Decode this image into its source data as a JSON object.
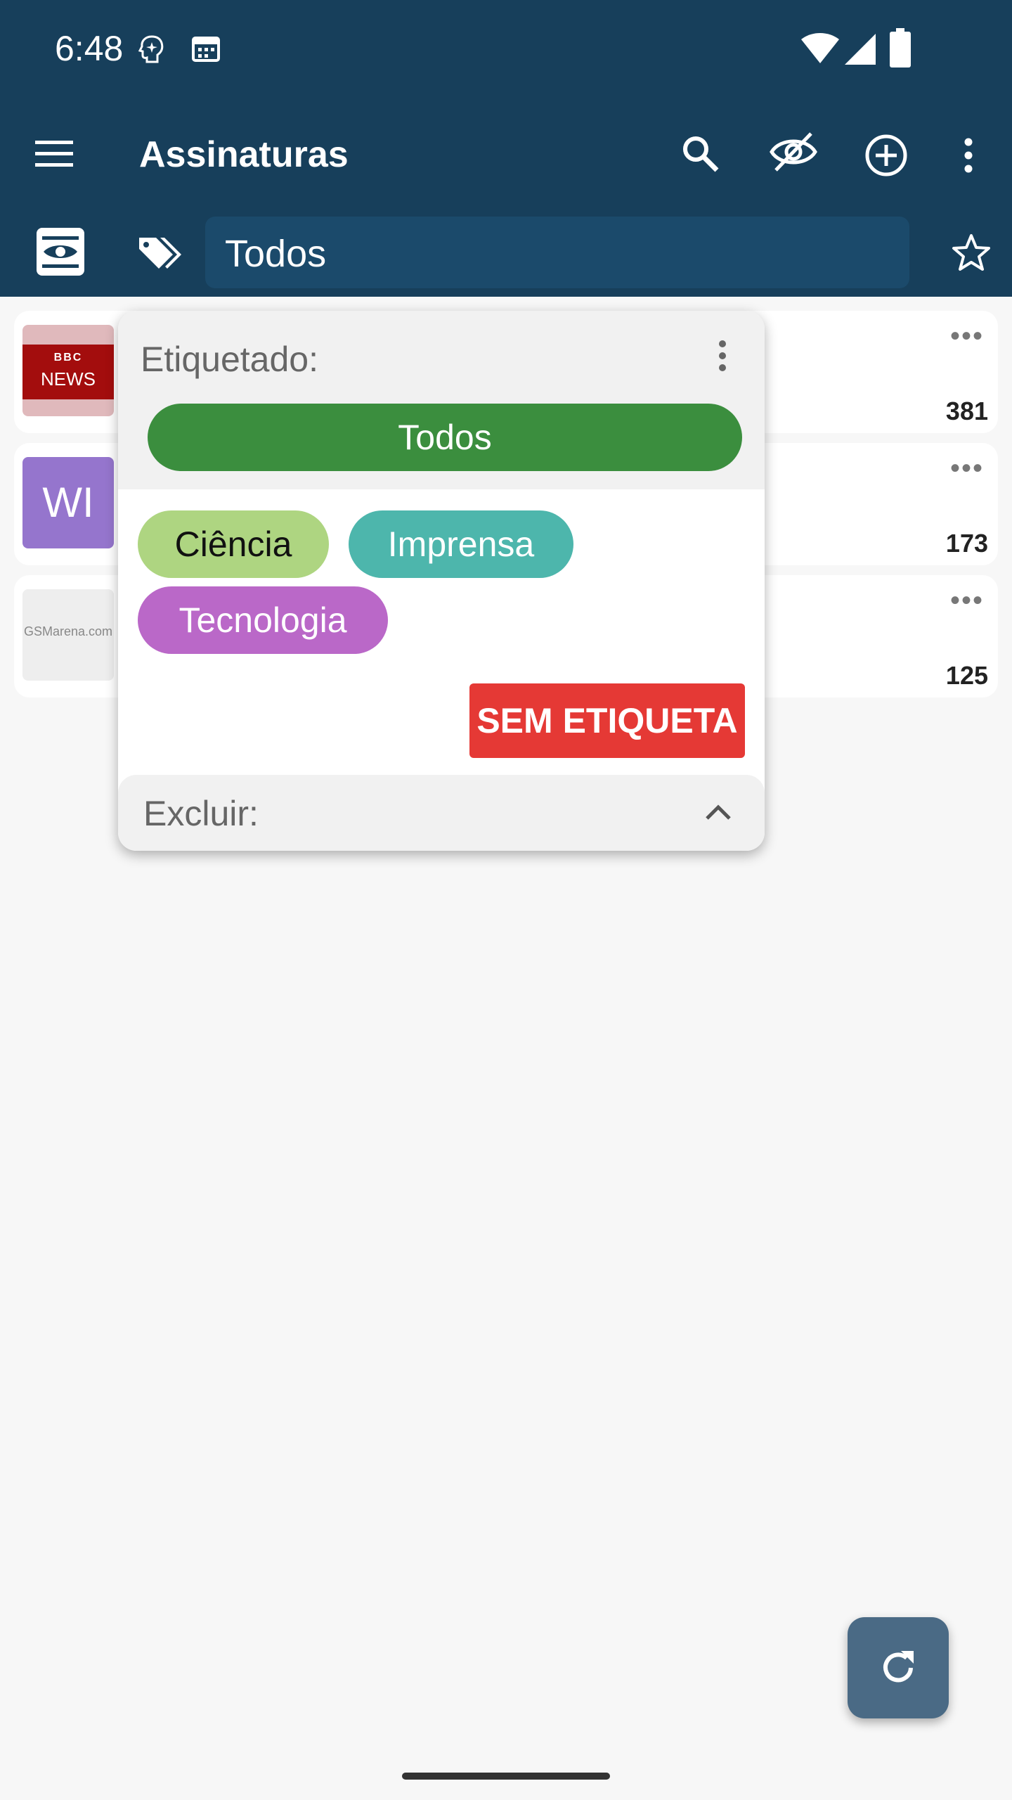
{
  "status_bar": {
    "time": "6:48"
  },
  "toolbar": {
    "title": "Assinaturas",
    "icons": [
      "menu-icon",
      "search-icon",
      "hide-read-icon",
      "add-icon",
      "more-vert-icon"
    ]
  },
  "filter_bar": {
    "selected_tag": "Todos",
    "icons": [
      "read-view-icon",
      "tags-icon",
      "star-icon"
    ]
  },
  "subscriptions": [
    {
      "logo_text_top": "BBC",
      "logo_text_bottom": "NEWS",
      "count": "381",
      "logo_bg": "#a30d0d"
    },
    {
      "logo_text": "WI",
      "count": "173",
      "logo_bg": "#9575cd"
    },
    {
      "logo_text": "GSMarena.com",
      "count": "125",
      "logo_bg": "#eeeeee"
    }
  ],
  "tag_popup": {
    "heading": "Etiquetado:",
    "all_label": "Todos",
    "tags": [
      {
        "label": "Ciência",
        "color": "#aed581",
        "text_color": "#111111"
      },
      {
        "label": "Imprensa",
        "color": "#4db6ac",
        "text_color": "#ffffff"
      },
      {
        "label": "Tecnologia",
        "color": "#ba68c8",
        "text_color": "#ffffff"
      }
    ],
    "untagged_label": "SEM ETIQUETA",
    "exclude_label": "Excluir:"
  },
  "colors": {
    "appbar": "#173f5b",
    "all_chip": "#3b8e3e",
    "untagged": "#e53935",
    "fab": "#4a6a85"
  }
}
